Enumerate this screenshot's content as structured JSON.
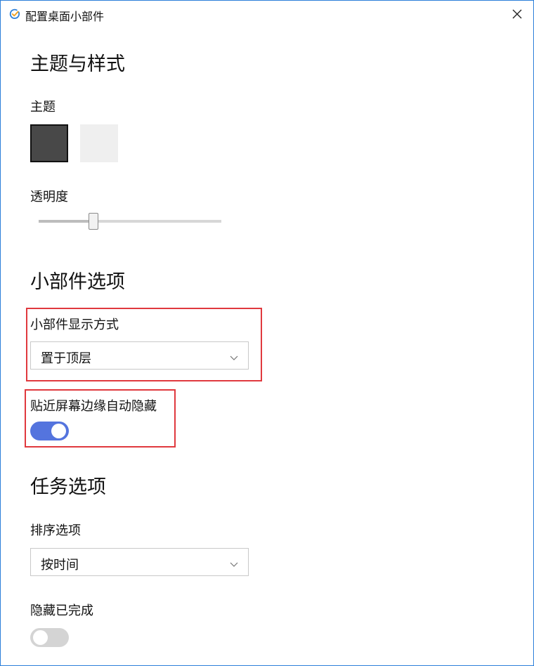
{
  "window": {
    "title": "配置桌面小部件",
    "icon": "check-circle-icon",
    "close_icon": "close-icon"
  },
  "theme_section": {
    "title": "主题与样式",
    "theme_label": "主题",
    "swatches": [
      {
        "name": "dark",
        "color": "#484848",
        "selected": true
      },
      {
        "name": "light",
        "color": "#efefef",
        "selected": false
      }
    ],
    "opacity_label": "透明度",
    "opacity_value_fraction": 0.3
  },
  "widget_section": {
    "title": "小部件选项",
    "display_mode_label": "小部件显示方式",
    "display_mode_value": "置于顶层",
    "auto_hide_label": "贴近屏幕边缘自动隐藏",
    "auto_hide_on": true
  },
  "task_section": {
    "title": "任务选项",
    "sort_label": "排序选项",
    "sort_value": "按时间",
    "hide_completed_label": "隐藏已完成",
    "hide_completed_on": false
  },
  "colors": {
    "accent": "#5474de",
    "highlight": "#e0393e",
    "window_border": "#2b7fd9"
  }
}
